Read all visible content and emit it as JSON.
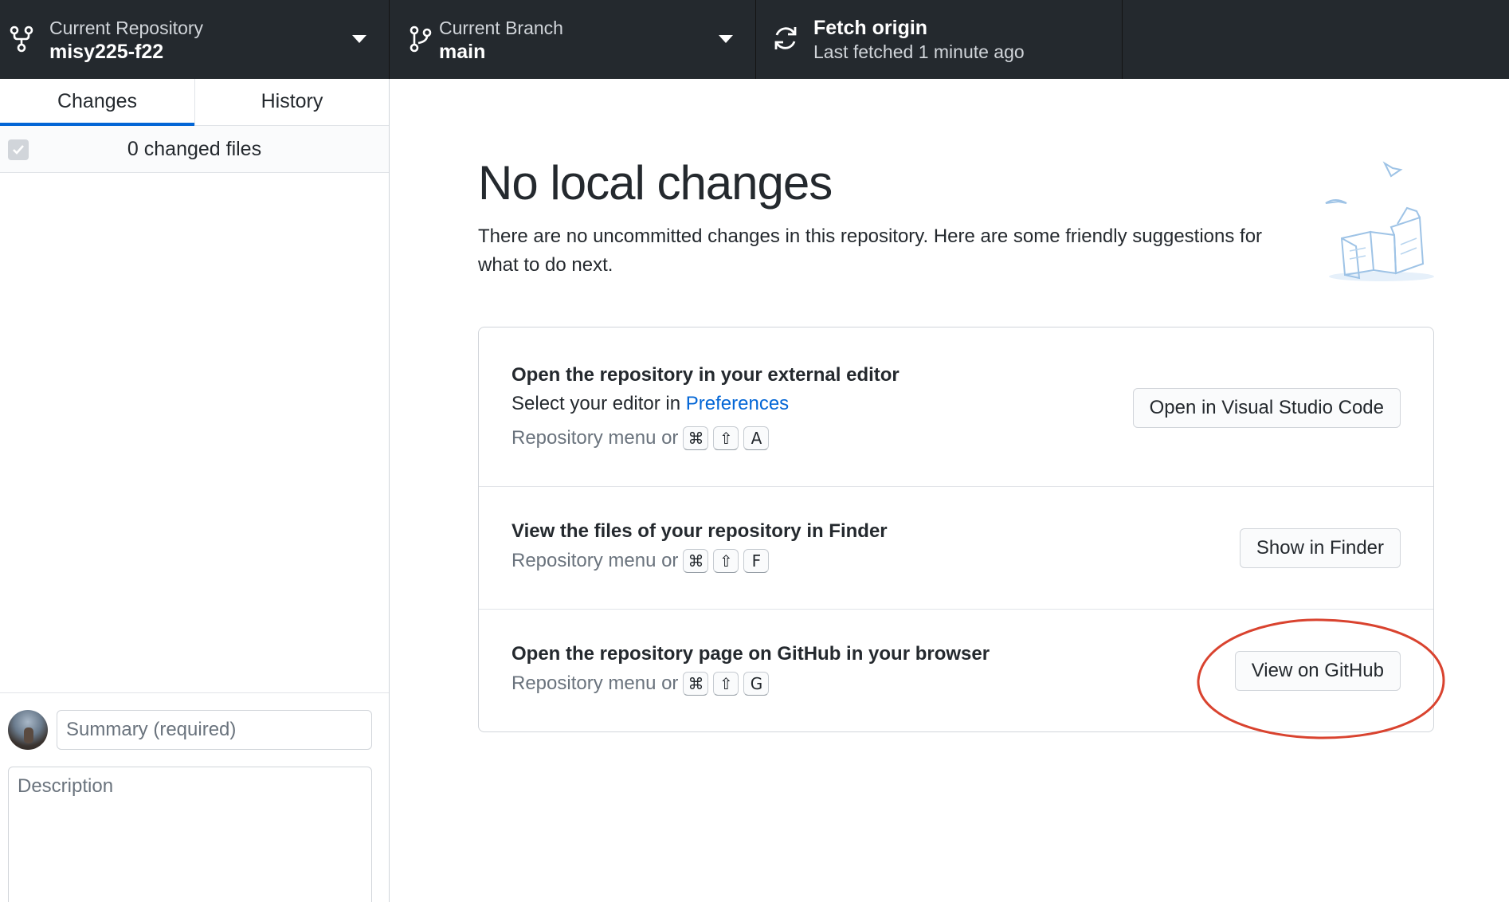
{
  "toolbar": {
    "repository": {
      "label": "Current Repository",
      "value": "misy225-f22"
    },
    "branch": {
      "label": "Current Branch",
      "value": "main"
    },
    "fetch": {
      "label": "Fetch origin",
      "status": "Last fetched 1 minute ago"
    }
  },
  "sidebar": {
    "tabs": [
      {
        "label": "Changes",
        "active": true
      },
      {
        "label": "History",
        "active": false
      }
    ],
    "changed_files_text": "0 changed files",
    "commit": {
      "summary_placeholder": "Summary (required)",
      "description_placeholder": "Description"
    }
  },
  "main": {
    "heading": "No local changes",
    "subtext": "There are no uncommitted changes in this repository. Here are some friendly suggestions for what to do next.",
    "suggestions": [
      {
        "title": "Open the repository in your external editor",
        "line_prefix": "Select your editor in ",
        "line_link": "Preferences",
        "hint_prefix": "Repository menu or",
        "keys": [
          "⌘",
          "⇧",
          "A"
        ],
        "button": "Open in Visual Studio Code"
      },
      {
        "title": "View the files of your repository in Finder",
        "hint_prefix": "Repository menu or",
        "keys": [
          "⌘",
          "⇧",
          "F"
        ],
        "button": "Show in Finder"
      },
      {
        "title": "Open the repository page on GitHub in your browser",
        "hint_prefix": "Repository menu or",
        "keys": [
          "⌘",
          "⇧",
          "G"
        ],
        "button": "View on GitHub"
      }
    ]
  },
  "colors": {
    "toolbar_bg": "#24292e",
    "accent": "#0366d6",
    "annotation": "#d9432f"
  },
  "icons": [
    "repo-fork-icon",
    "branch-icon",
    "sync-icon",
    "caret-down-icon",
    "check-icon"
  ]
}
